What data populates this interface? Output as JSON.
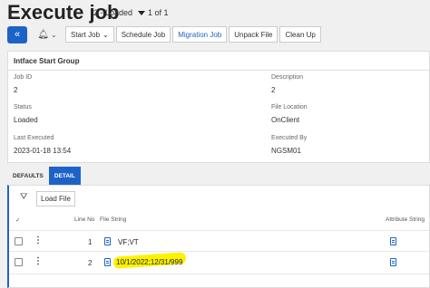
{
  "header": {
    "title": "Execute job",
    "status": "2 - Loaded",
    "pager": "1 of 1"
  },
  "toolbar": {
    "buttons": [
      "Start Job",
      "Schedule Job",
      "Migration Job",
      "Unpack File",
      "Clean Up"
    ]
  },
  "card": {
    "title": "Intface Start Group",
    "fields": [
      {
        "label": "Job ID",
        "value": "2"
      },
      {
        "label": "Description",
        "value": "2"
      },
      {
        "label": "Status",
        "value": "Loaded"
      },
      {
        "label": "File Location",
        "value": "OnClient"
      },
      {
        "label": "Last Executed",
        "value": "2023-01-18 13:54"
      },
      {
        "label": "Executed By",
        "value": "NGSM01"
      }
    ]
  },
  "tabs": [
    "DEFAULTS",
    "DETAIL"
  ],
  "detail": {
    "load_file_label": "Load File",
    "columns": {
      "line_no": "Line No",
      "file_string": "File String",
      "attribute_string": "Attribute String"
    },
    "rows": [
      {
        "line_no": "1",
        "file_string": "VF;VT"
      },
      {
        "line_no": "2",
        "file_string": "10/1/2022;12/31/999"
      }
    ]
  },
  "colors": {
    "accent": "#1d63c7",
    "highlight": "#fff200"
  }
}
